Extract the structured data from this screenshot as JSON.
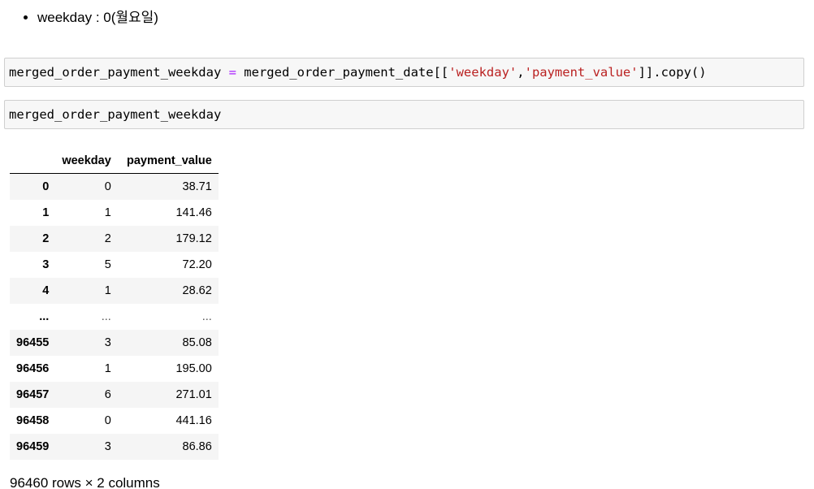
{
  "markdown": {
    "bullet": "weekday : 0(월요일)"
  },
  "cells": [
    {
      "code_tokens": [
        {
          "text": "merged_order_payment_weekday ",
          "type": "plain"
        },
        {
          "text": "=",
          "type": "op"
        },
        {
          "text": " merged_order_payment_date[[",
          "type": "plain"
        },
        {
          "text": "'weekday'",
          "type": "str"
        },
        {
          "text": ",",
          "type": "plain"
        },
        {
          "text": "'payment_value'",
          "type": "str"
        },
        {
          "text": "]].copy()",
          "type": "plain"
        }
      ]
    },
    {
      "code_tokens": [
        {
          "text": "merged_order_payment_weekday",
          "type": "plain"
        }
      ]
    }
  ],
  "dataframe": {
    "columns": [
      "weekday",
      "payment_value"
    ],
    "rows": [
      {
        "index": "0",
        "weekday": "0",
        "payment_value": "38.71"
      },
      {
        "index": "1",
        "weekday": "1",
        "payment_value": "141.46"
      },
      {
        "index": "2",
        "weekday": "2",
        "payment_value": "179.12"
      },
      {
        "index": "3",
        "weekday": "5",
        "payment_value": "72.20"
      },
      {
        "index": "4",
        "weekday": "1",
        "payment_value": "28.62"
      },
      {
        "index": "...",
        "weekday": "...",
        "payment_value": "..."
      },
      {
        "index": "96455",
        "weekday": "3",
        "payment_value": "85.08"
      },
      {
        "index": "96456",
        "weekday": "1",
        "payment_value": "195.00"
      },
      {
        "index": "96457",
        "weekday": "6",
        "payment_value": "271.01"
      },
      {
        "index": "96458",
        "weekday": "0",
        "payment_value": "441.16"
      },
      {
        "index": "96459",
        "weekday": "3",
        "payment_value": "86.86"
      }
    ],
    "shape_text": "96460 rows × 2 columns"
  },
  "colors": {
    "code_background": "#f7f7f7",
    "code_border": "#cfcfcf",
    "operator": "#aa22ff",
    "string": "#ba2121",
    "stripe": "#f5f5f5"
  }
}
